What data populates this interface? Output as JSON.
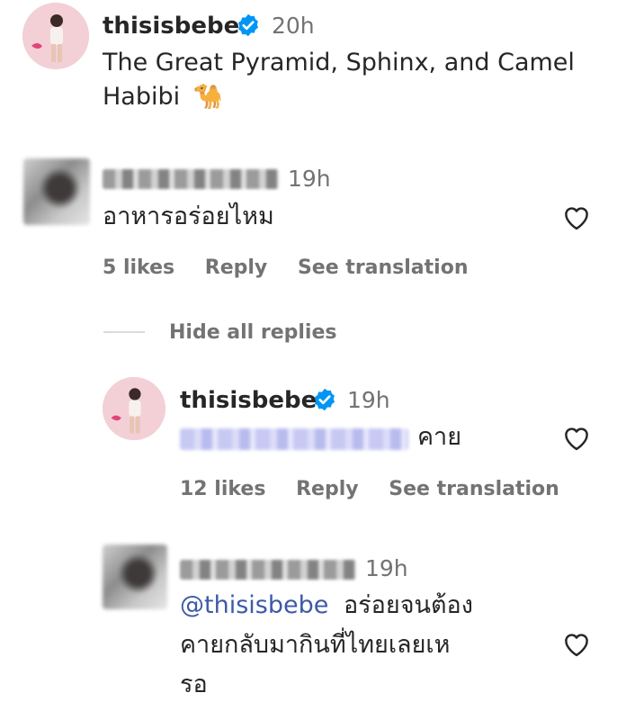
{
  "post": {
    "username": "thisisbebe",
    "time": "20h",
    "caption_line1": "The Great Pyramid, Sphinx, and Camel",
    "caption_line2": "Habibi",
    "caption_emoji": "🐪"
  },
  "comment1": {
    "time": "19h",
    "text": "อาหารอร่อยไหม",
    "likes": "5 likes",
    "reply_label": "Reply",
    "translate_label": "See translation",
    "hide_replies_label": "Hide all replies"
  },
  "reply1": {
    "username": "thisisbebe",
    "time": "19h",
    "text": "คาย",
    "likes": "12 likes",
    "reply_label": "Reply",
    "translate_label": "See translation"
  },
  "reply2": {
    "time": "19h",
    "mention": "@thisisbebe",
    "text_line1": "อร่อยจนต้อง",
    "text_line2": "คายกลับมากินที่ไทยเลยเห",
    "text_line3": "รอ"
  },
  "colors": {
    "verified": "#0095f6",
    "mention": "#3d5aa8",
    "secondary": "#737373"
  }
}
